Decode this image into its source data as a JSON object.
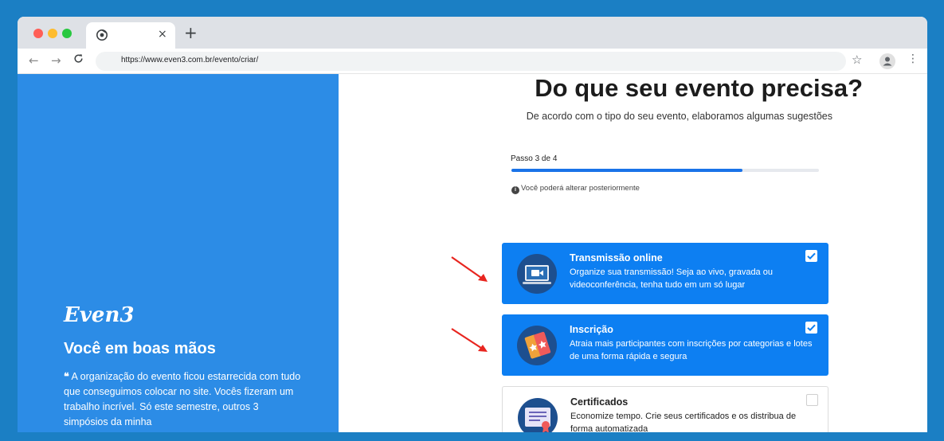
{
  "browser": {
    "url": "https://www.even3.com.br/evento/criar/",
    "tab_close": "×",
    "new_tab": "+",
    "back": "←",
    "forward": "→",
    "reload": "C",
    "star": "☆",
    "menu": "⋮"
  },
  "sidebar": {
    "brand": "Even3",
    "tagline": "Você em boas mãos",
    "quote_mark": "❝",
    "quote": " A organização do evento ficou estarrecida com tudo que conseguimos colocar no site. Vocês fizeram um trabalho incrível. Só este semestre, outros 3 simpósios da minha"
  },
  "main": {
    "heading": "Do que seu evento precisa?",
    "subheading": "De acordo com o tipo do seu evento, elaboramos algumas sugestões",
    "step_label": "Passo 3 de 4",
    "progress_fraction": 0.75,
    "hint": "Você poderá alterar posteriormente",
    "options": [
      {
        "title": "Transmissão online",
        "description": "Organize sua transmissão! Seja ao vivo, gravada ou videoconferência, tenha tudo em um só lugar",
        "selected": true
      },
      {
        "title": "Inscrição",
        "description": "Atraia mais participantes com inscrições por categorias e lotes de uma forma rápida e segura",
        "selected": true
      },
      {
        "title": "Certificados",
        "description": "Economize tempo. Crie seus certificados e os distribua de forma automatizada",
        "selected": false
      }
    ]
  },
  "colors": {
    "page_background": "#1b7fc4",
    "sidebar": "#2c8ce6",
    "selected_card": "#0d7ff2",
    "progress": "#1a73e8",
    "annotation_arrow": "#e8251f"
  }
}
